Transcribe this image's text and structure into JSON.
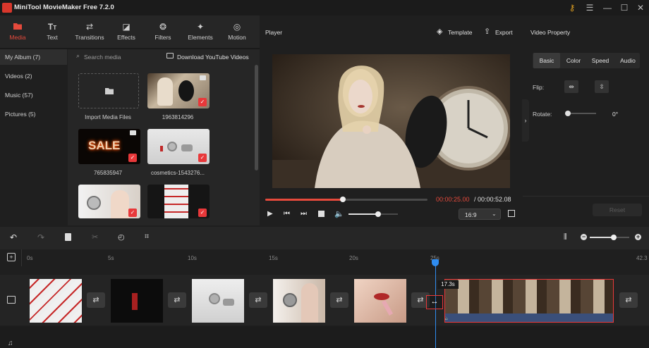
{
  "app": {
    "title": "MiniTool MovieMaker Free 7.2.0"
  },
  "toolbar": {
    "tabs": [
      {
        "label": "Media",
        "icon": "folder-icon"
      },
      {
        "label": "Text",
        "icon": "text-icon"
      },
      {
        "label": "Transitions",
        "icon": "transitions-icon"
      },
      {
        "label": "Effects",
        "icon": "effects-icon"
      },
      {
        "label": "Filters",
        "icon": "filters-icon"
      },
      {
        "label": "Elements",
        "icon": "elements-icon"
      },
      {
        "label": "Motion",
        "icon": "motion-icon"
      }
    ]
  },
  "sidebar": {
    "items": [
      {
        "label": "My Album (7)"
      },
      {
        "label": "Videos (2)"
      },
      {
        "label": "Music (57)"
      },
      {
        "label": "Pictures (5)"
      }
    ]
  },
  "media": {
    "search_placeholder": "Search media",
    "download_label": "Download YouTube Videos",
    "import_label": "Import Media Files",
    "items": [
      {
        "name": "1963814296"
      },
      {
        "name": "765835947"
      },
      {
        "name": "cosmetics-1543276..."
      }
    ],
    "sale_text": "SALE"
  },
  "player": {
    "label": "Player",
    "template_label": "Template",
    "export_label": "Export",
    "time_current": "00:00:25.00",
    "time_total": " / 00:00:52.08",
    "aspect": "16:9",
    "progress": 0.48,
    "volume": 0.6
  },
  "props": {
    "title": "Video Property",
    "tabs": [
      "Basic",
      "Color",
      "Speed",
      "Audio"
    ],
    "flip_label": "Flip:",
    "rotate_label": "Rotate:",
    "rotate_value": "0°",
    "reset_label": "Reset"
  },
  "timeline": {
    "ticks": [
      "0s",
      "5s",
      "10s",
      "15s",
      "20s",
      "25s",
      "42.3"
    ],
    "clip_duration": "17.3s",
    "zoom": 0.6
  },
  "colors": {
    "accent": "#e64a3c",
    "playhead": "#2f8cf0",
    "selected_clip": "#e8383a"
  }
}
